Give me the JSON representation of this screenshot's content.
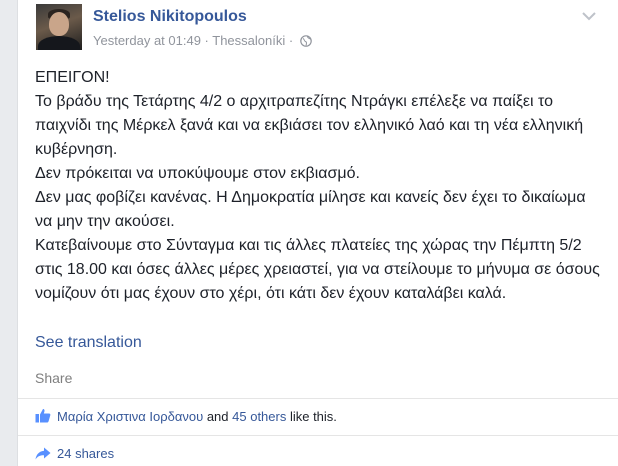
{
  "post": {
    "author": "Stelios Nikitopoulos",
    "timestamp": "Yesterday at 01:49",
    "separator": " · ",
    "location": "Thessaloníki",
    "separator2": " · ",
    "paragraphs": [
      "ΕΠΕΙΓΟΝ!",
      "Το βράδυ της Τετάρτης 4/2 ο αρχιτραπεζίτης Ντράγκι επέλεξε να παίξει το παιχνίδι της Μέρκελ ξανά και να εκβιάσει τον ελληνικό λαό και τη νέα ελληνική κυβέρνηση.",
      "Δεν πρόκειται να υποκύψουμε στον εκβιασμό.",
      "Δεν μας φοβίζει κανένας. Η Δημοκρατία μίλησε και κανείς δεν έχει το δικαίωμα να μην την ακούσει.",
      "Κατεβαίνουμε στο Σύνταγμα και τις άλλες πλατείες της χώρας την Πέμπτη 5/2 στις 18.00 και όσες άλλες μέρες χρειαστεί, για να στείλουμε το μήνυμα σε όσους νομίζουν ότι μας έχουν στο χέρι, ότι κάτι δεν έχουν καταλάβει καλά."
    ],
    "see_translation": "See translation",
    "share": "Share"
  },
  "likes": {
    "liker": "Μαρία Χριστινα Ιορδανου",
    "and": " and ",
    "others": "45 others",
    "suffix": " like this."
  },
  "shares": {
    "label": "24 shares"
  },
  "icons": {
    "globe": "globe-icon",
    "chevron": "chevron-down-icon",
    "like": "thumbs-up-icon",
    "share": "share-icon"
  },
  "colors": {
    "link": "#365899",
    "text": "#1d2129",
    "meta": "#90949c"
  }
}
